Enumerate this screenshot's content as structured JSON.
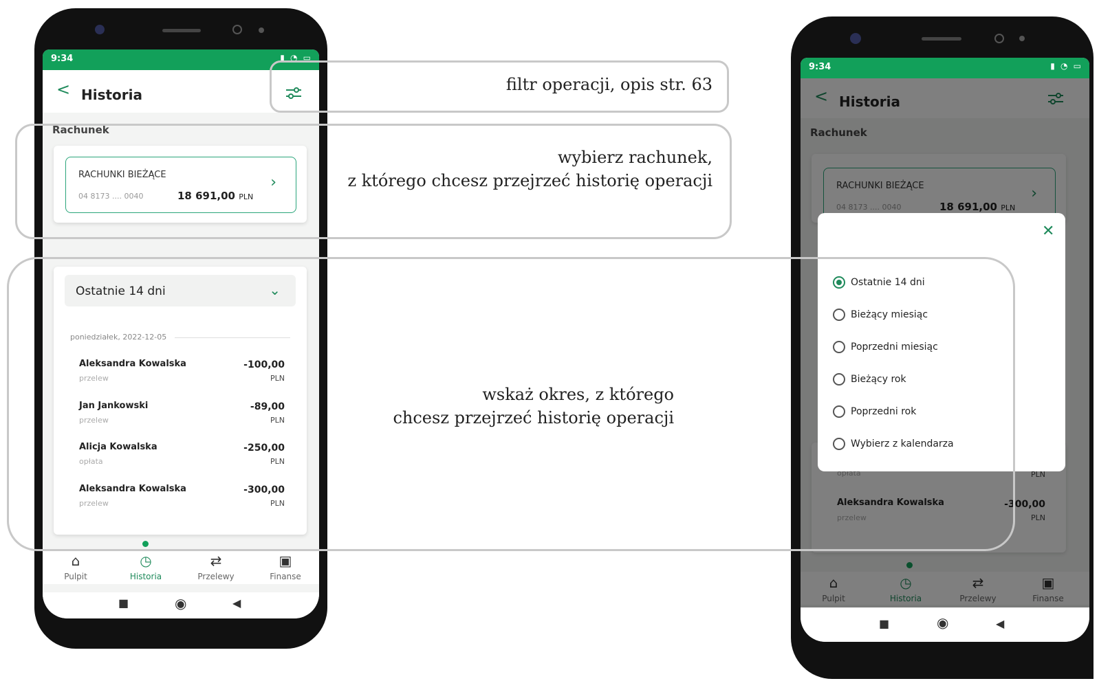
{
  "left_phone": {
    "status_time": "9:34",
    "status_icons": "▮ ◔ ▭",
    "back_glyph": "<",
    "title": "Historia",
    "section_label": "Rachunek",
    "account": {
      "name": "RACHUNKI BIEŻĄCE",
      "number": "04 8173 .... 0040",
      "balance": "18 691,00",
      "currency": "PLN"
    },
    "period_label": "Ostatnie 14 dni",
    "date_label": "poniedziałek, 2022-12-05",
    "transactions": [
      {
        "name": "Aleksandra Kowalska",
        "type": "przelew",
        "amount": "-100,00",
        "currency": "PLN"
      },
      {
        "name": "Jan Jankowski",
        "type": "przelew",
        "amount": "-89,00",
        "currency": "PLN"
      },
      {
        "name": "Alicja Kowalska",
        "type": "opłata",
        "amount": "-250,00",
        "currency": "PLN"
      },
      {
        "name": "Aleksandra Kowalska",
        "type": "przelew",
        "amount": "-300,00",
        "currency": "PLN"
      }
    ],
    "nav": [
      {
        "label": "Pulpit",
        "icon": "⌂"
      },
      {
        "label": "Historia",
        "icon": "◷"
      },
      {
        "label": "Przelewy",
        "icon": "⇄"
      },
      {
        "label": "Finanse",
        "icon": "▣"
      }
    ],
    "android_keys": [
      "■",
      "◉",
      "◀"
    ]
  },
  "captions": {
    "filter": "filtr operacji, opis str. 63",
    "account_line1": "wybierz rachunek,",
    "account_line2": "z którego chcesz przejrzeć historię operacji",
    "period_line1": "wskaż okres, z którego",
    "period_line2": "chcesz przejrzeć historię operacji"
  },
  "right_phone": {
    "status_time": "9:34",
    "status_icons": "▮ ◔ ▭",
    "back_glyph": "<",
    "title": "Historia",
    "section_label": "Rachunek",
    "account": {
      "name": "RACHUNKI BIEŻĄCE",
      "number": "04 8173 .... 0040",
      "balance": "18 691,00",
      "currency": "PLN"
    },
    "close_glyph": "✕",
    "options": [
      "Ostatnie 14 dni",
      "Bieżący miesiąc",
      "Poprzedni miesiąc",
      "Bieżący rok",
      "Poprzedni rok",
      "Wybierz z kalendarza"
    ],
    "selected_option": "Ostatnie 14 dni",
    "behind_type": "opłata",
    "behind_cur": "PLN",
    "behind_name": "Aleksandra Kowalska",
    "behind_type2": "przelew",
    "behind_amount": "-300,00",
    "behind_cur2": "PLN",
    "nav": [
      {
        "label": "Pulpit",
        "icon": "⌂"
      },
      {
        "label": "Historia",
        "icon": "◷"
      },
      {
        "label": "Przelewy",
        "icon": "⇄"
      },
      {
        "label": "Finanse",
        "icon": "▣"
      }
    ],
    "android_keys": [
      "■",
      "◉",
      "◀"
    ]
  },
  "colors": {
    "brand_green": "#12a05a",
    "accent_green": "#1f8a5b"
  }
}
